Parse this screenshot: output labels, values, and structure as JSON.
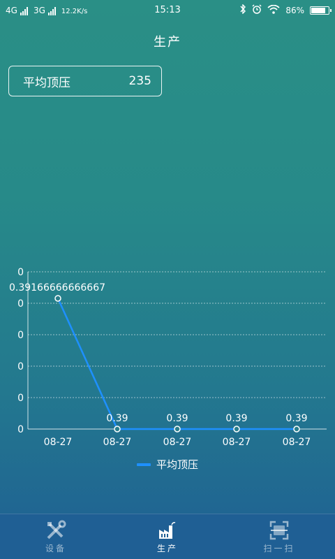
{
  "status_bar": {
    "network1": "4G",
    "network2": "3G",
    "speed": "12.2K/s",
    "time": "15:13",
    "battery": "86%",
    "battery_level": 0.86
  },
  "header": {
    "title": "生产"
  },
  "stat_card": {
    "label": "平均顶压",
    "value": "235"
  },
  "chart_data": {
    "type": "line",
    "categories": [
      "08-27",
      "08-27",
      "08-27",
      "08-27",
      "08-27"
    ],
    "series": [
      {
        "name": "平均顶压",
        "values": [
          0.39166666666667,
          0.39,
          0.39,
          0.39,
          0.39
        ]
      }
    ],
    "data_labels": [
      "0.39166666666667",
      "0.39",
      "0.39",
      "0.39",
      "0.39"
    ],
    "y_tick_labels": [
      "0",
      "0",
      "0",
      "0",
      "0",
      "0"
    ],
    "grid": true,
    "legend": "bottom-center",
    "line_color": "#1e90ff"
  },
  "bottom_nav": {
    "items": [
      {
        "label": "设备",
        "icon": "wrench-tools-icon",
        "active": false
      },
      {
        "label": "生产",
        "icon": "factory-icon",
        "active": true
      },
      {
        "label": "扫一扫",
        "icon": "scan-icon",
        "active": false
      }
    ]
  }
}
